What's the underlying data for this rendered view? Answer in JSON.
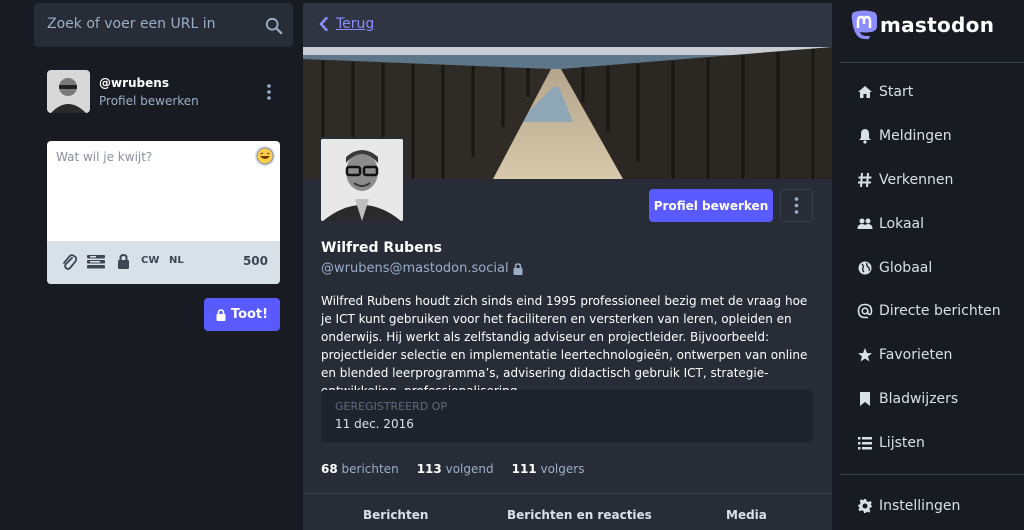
{
  "search": {
    "placeholder": "Zoek of voer een URL in"
  },
  "account": {
    "acct": "@wrubens",
    "edit_profile": "Profiel bewerken"
  },
  "compose": {
    "placeholder": "Wat wil je kwijt?",
    "cw": "CW",
    "lang": "NL",
    "char_count": "500",
    "toot": "Toot!"
  },
  "profile": {
    "back": "Terug",
    "edit_button": "Profiel bewerken",
    "name": "Wilfred Rubens",
    "handle": "@wrubens@mastodon.social",
    "bio": "Wilfred Rubens houdt zich sinds eind 1995 professioneel bezig met de vraag hoe je ICT kunt gebruiken voor het faciliteren en versterken van leren, opleiden en onderwijs. Hij werkt als zelfstandig adviseur en projectleider. Bijvoorbeeld: projectleider selectie en implementatie leertechnologieën, ontwerpen van online en blended leerprogramma’s, advisering didactisch gebruik ICT, strategie-ontwikkeling, professionalisering.",
    "field_label": "GEREGISTREERD OP",
    "field_value": "11 dec. 2016",
    "posts_count": "68",
    "posts_label": "berichten",
    "following_count": "113",
    "following_label": "volgend",
    "followers_count": "111",
    "followers_label": "volgers",
    "tabs": [
      "Berichten",
      "Berichten en reacties",
      "Media"
    ]
  },
  "nav": {
    "logo": "mastodon",
    "items": [
      "Start",
      "Meldingen",
      "Verkennen",
      "Lokaal",
      "Globaal",
      "Directe berichten",
      "Favorieten",
      "Bladwijzers",
      "Lijsten"
    ],
    "settings": "Instellingen"
  },
  "colors": {
    "accent": "#595aff",
    "background": "#191b22",
    "panel": "#282c37",
    "link": "#8c8dff"
  }
}
